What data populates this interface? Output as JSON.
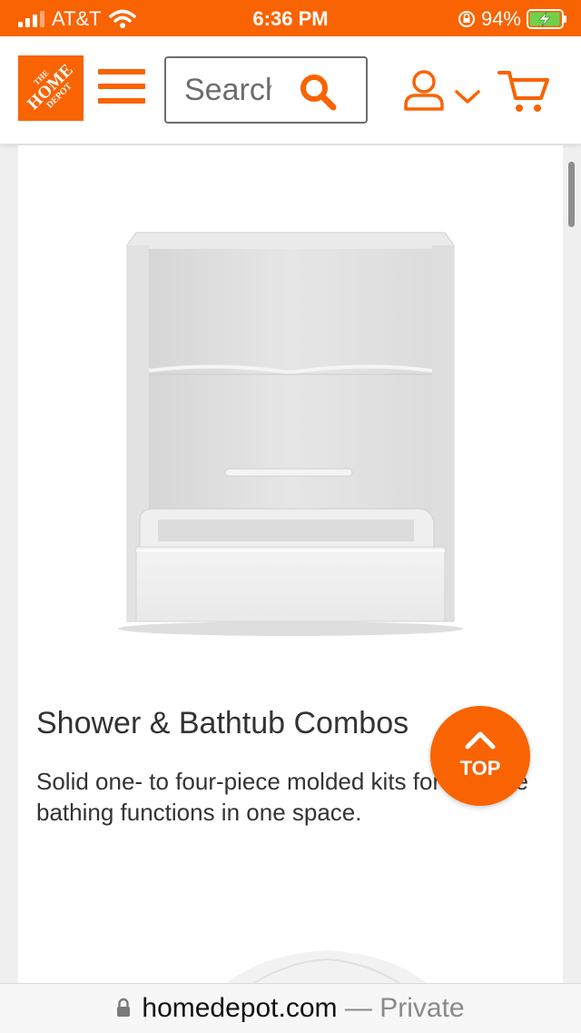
{
  "status_bar": {
    "carrier": "AT&T",
    "time": "6:36 PM",
    "battery": "94%"
  },
  "header": {
    "logo": {
      "line1": "THE",
      "line2": "HOME",
      "line3": "DEPOT"
    },
    "search_placeholder": "Search"
  },
  "product": {
    "title": "Shower & Bathtub Combos",
    "description": "Solid one- to four-piece molded kits for multiple bathing functions in one space."
  },
  "top_button": {
    "label": "TOP"
  },
  "address_bar": {
    "domain": "homedepot.com",
    "separator": "—",
    "mode": "Private"
  },
  "colors": {
    "brand_orange": "#f96302",
    "text": "#333333",
    "muted": "#8a8a8a"
  },
  "icons": [
    "signal-icon",
    "wifi-icon",
    "rotation-lock-icon",
    "battery-charging-icon",
    "menu-icon",
    "search-icon",
    "user-icon",
    "chevron-down-icon",
    "cart-icon",
    "arrow-up-icon",
    "padlock-icon"
  ]
}
